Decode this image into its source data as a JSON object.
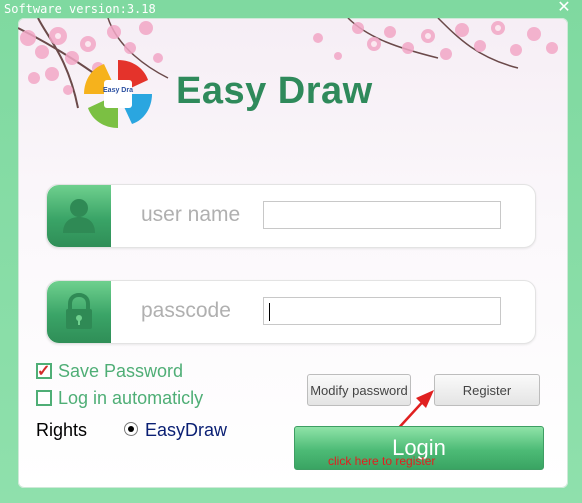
{
  "window": {
    "title": "Software version:3.18",
    "close_symbol": "✕"
  },
  "app": {
    "title": "Easy Draw",
    "logo_text": "Easy Dra"
  },
  "form": {
    "username_label": "user name",
    "username_value": "",
    "passcode_label": "passcode",
    "passcode_value": "",
    "save_password_label": "Save Password",
    "save_password_checked": true,
    "auto_login_label": "Log in automaticly",
    "auto_login_checked": false,
    "rights_label": "Rights",
    "rights_option": "EasyDraw"
  },
  "buttons": {
    "modify_password": "Modify password",
    "register": "Register",
    "login": "Login"
  },
  "annotation": {
    "hint": "click here to register"
  },
  "colors": {
    "accent": "#3aa467",
    "title": "#2f8a5b",
    "hint": "#e02020"
  }
}
